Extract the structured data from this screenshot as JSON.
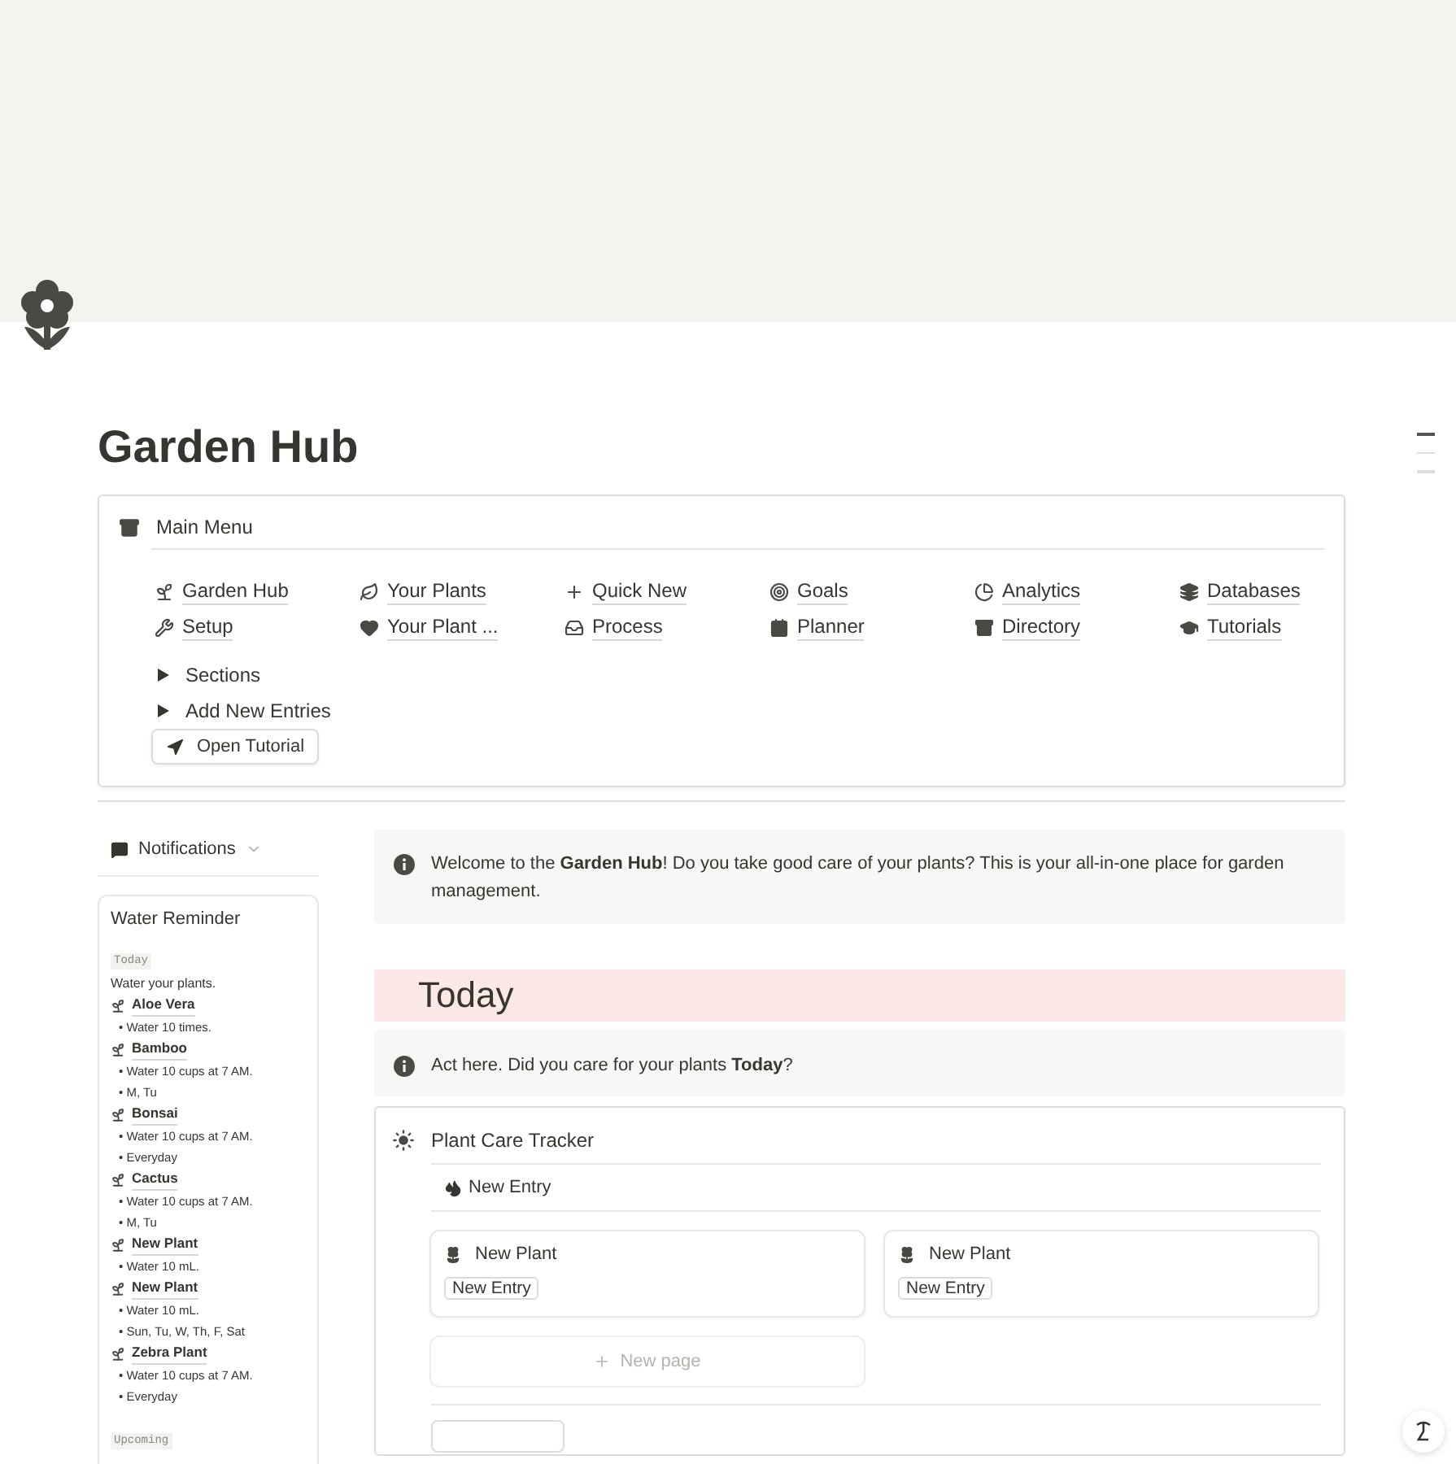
{
  "page": {
    "title": "Garden Hub"
  },
  "main_menu": {
    "title": "Main Menu",
    "links": [
      {
        "label": "Garden Hub"
      },
      {
        "label": "Your Plants"
      },
      {
        "label": "Quick New"
      },
      {
        "label": "Goals"
      },
      {
        "label": "Analytics"
      },
      {
        "label": "Databases"
      },
      {
        "label": "Setup"
      },
      {
        "label": "Your Plant ..."
      },
      {
        "label": "Process"
      },
      {
        "label": "Planner"
      },
      {
        "label": "Directory"
      },
      {
        "label": "Tutorials"
      }
    ],
    "toggles": [
      {
        "label": "Sections",
        "expanded": false
      },
      {
        "label": "Add New Entries",
        "expanded": false
      }
    ],
    "button": "Open Tutorial"
  },
  "notifications": {
    "label": "Notifications",
    "card": {
      "title": "Water Reminder",
      "sections": [
        {
          "label": "Today",
          "note": "Water your plants.",
          "plants": [
            {
              "name": "Aloe Vera",
              "details": [
                "• Water 10 times."
              ]
            },
            {
              "name": "Bamboo",
              "details": [
                "• Water 10 cups at 7 AM.",
                "• M, Tu"
              ]
            },
            {
              "name": "Bonsai",
              "details": [
                "• Water 10 cups at 7 AM.",
                "• Everyday"
              ]
            },
            {
              "name": "Cactus",
              "details": [
                "• Water 10 cups at 7 AM.",
                "• M, Tu"
              ]
            },
            {
              "name": "New Plant",
              "details": [
                "• Water 10 mL."
              ]
            },
            {
              "name": "New Plant",
              "details": [
                "• Water 10 mL.",
                "• Sun, Tu, W, Th, F, Sat"
              ]
            },
            {
              "name": "Zebra Plant",
              "details": [
                "• Water 10 cups at 7 AM.",
                "• Everyday"
              ]
            }
          ]
        },
        {
          "label": "Upcoming"
        }
      ]
    }
  },
  "welcome_callout": "Welcome to the **Garden Hub**! Do you take good care of your plants? This is your all-in-one place for garden management.",
  "today": {
    "heading": "Today",
    "callout": "Act here. Did you care for your plants **Today**?",
    "tracker": {
      "title": "Plant Care Tracker",
      "view": "New Entry",
      "cards": [
        {
          "title": "New Plant",
          "tag": "New Entry"
        },
        {
          "title": "New Plant",
          "tag": "New Entry"
        }
      ],
      "new_page": "New page"
    }
  }
}
